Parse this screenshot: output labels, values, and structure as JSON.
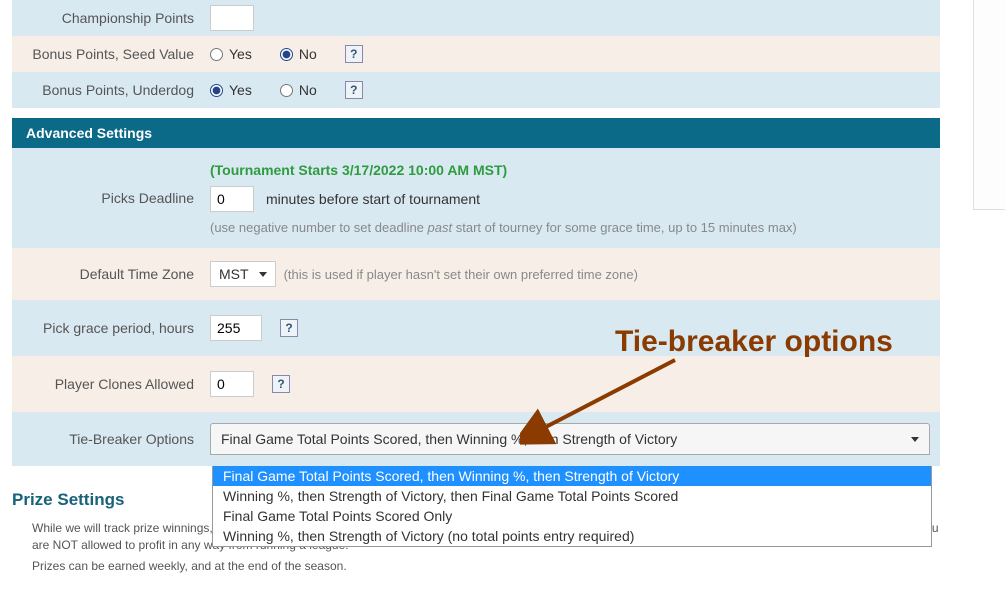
{
  "rows": {
    "championship": {
      "label": "Championship Points"
    },
    "bonus_seed": {
      "label": "Bonus Points, Seed Value",
      "yes": "Yes",
      "no": "No",
      "selected": "no"
    },
    "bonus_underdog": {
      "label": "Bonus Points, Underdog",
      "yes": "Yes",
      "no": "No",
      "selected": "yes"
    }
  },
  "advanced_header": "Advanced Settings",
  "picks_deadline": {
    "label": "Picks Deadline",
    "tournament_note": "(Tournament Starts 3/17/2022 10:00 AM MST)",
    "value": "0",
    "suffix": "minutes before start of tournament",
    "hint_pre": "(use negative number to set deadline ",
    "hint_em": "past",
    "hint_post": " start of tourney for some grace time, up to 15 minutes max)"
  },
  "default_tz": {
    "label": "Default Time Zone",
    "value": "MST",
    "hint": "(this is used if player hasn't set their own preferred time zone)"
  },
  "grace_period": {
    "label": "Pick grace period, hours",
    "value": "255"
  },
  "clones": {
    "label": "Player Clones Allowed",
    "value": "0"
  },
  "tiebreaker": {
    "label": "Tie-Breaker Options",
    "selected": "Final Game Total Points Scored, then Winning %, then Strength of Victory",
    "options": [
      "Final Game Total Points Scored, then Winning %, then Strength of Victory",
      "Winning %, then Strength of Victory, then Final Game Total Points Scored",
      "Final Game Total Points Scored Only",
      "Winning %, then Strength of Victory (no total points entry required)"
    ]
  },
  "prize_heading": "Prize Settings",
  "fine_print_1": "While we will track prize winnings, we do not handle payment reception or distribution of prizes for your league. It is up to you to collect fees and pay the prize winners. You are NOT allowed to profit in any way from running a league.",
  "fine_print_2": "Prizes can be earned weekly, and at the end of the season.",
  "help_glyph": "?",
  "annotation": "Tie-breaker options"
}
